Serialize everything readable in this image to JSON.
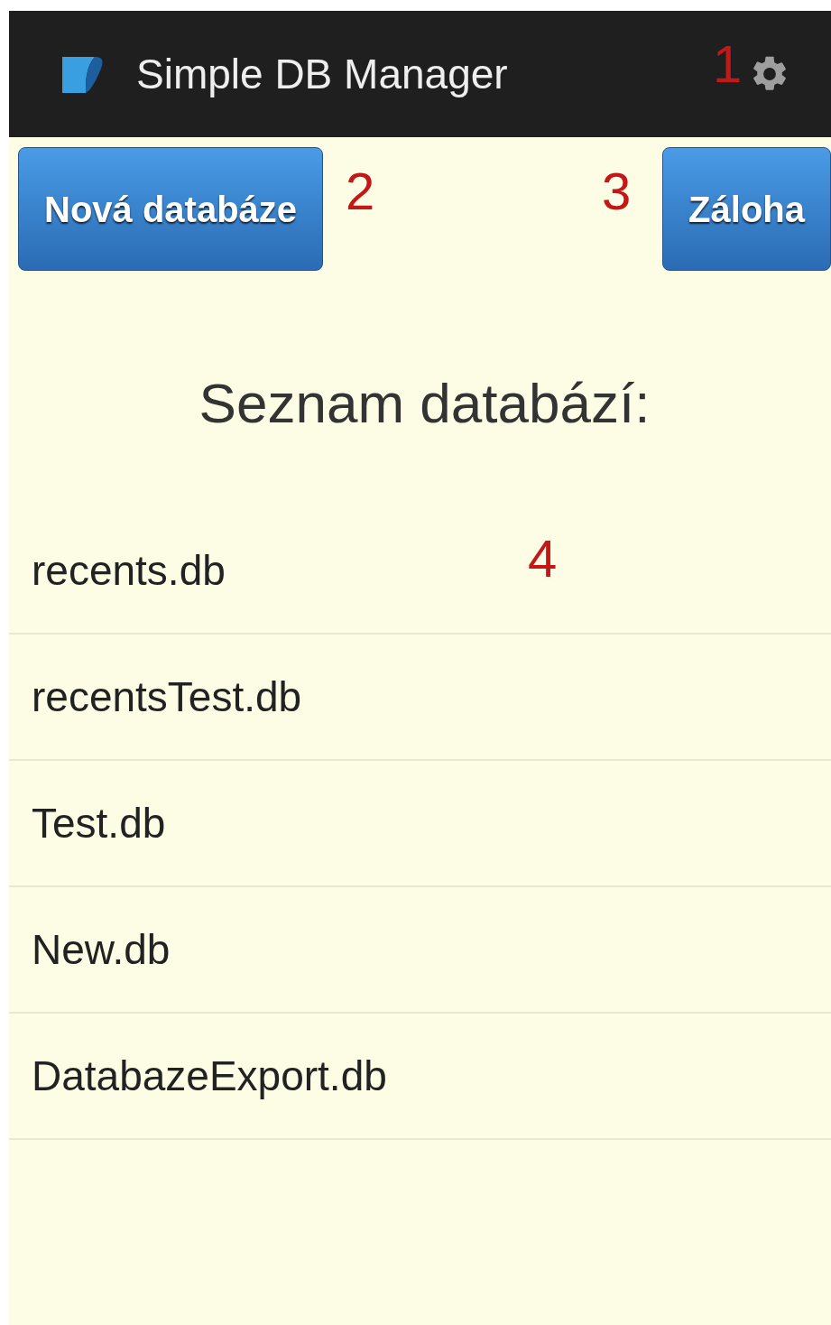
{
  "app_bar": {
    "title": "Simple DB Manager",
    "annotation": "1"
  },
  "buttons": [
    {
      "label": "Nová databáze",
      "annotation": "2"
    },
    {
      "label": "Záloha",
      "annotation": "3"
    }
  ],
  "heading": "Seznam databází:",
  "list_annotation": "4",
  "databases": [
    {
      "name": "recents.db"
    },
    {
      "name": "recentsTest.db"
    },
    {
      "name": "Test.db"
    },
    {
      "name": "New.db"
    },
    {
      "name": "DatabazeExport.db"
    }
  ]
}
